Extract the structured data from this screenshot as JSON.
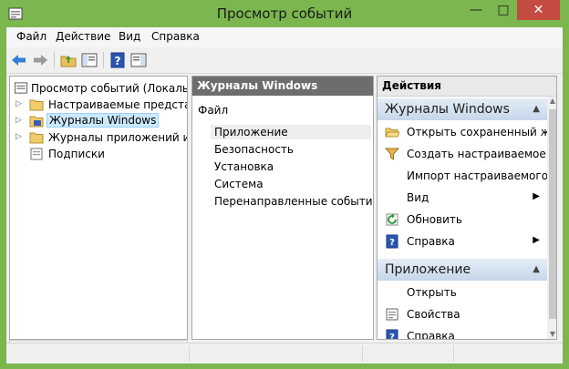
{
  "window": {
    "title": "Просмотр событий",
    "accent": "#7bb64e"
  },
  "titlebar": {
    "minimize": "—",
    "maximize": "□",
    "close": "✕"
  },
  "menubar": {
    "items": [
      "Файл",
      "Действие",
      "Вид",
      "Справка"
    ]
  },
  "toolbar": {
    "icons": [
      "back-arrow-icon",
      "forward-arrow-icon",
      "up-folder-icon",
      "show-hide-tree-icon",
      "help-icon",
      "show-hide-action-pane-icon"
    ]
  },
  "tree": {
    "root": "Просмотр событий (Локальный)",
    "items": [
      {
        "label": "Настраиваемые представления",
        "icon": "folder-icon",
        "expandable": true
      },
      {
        "label": "Журналы Windows",
        "icon": "folder-log-icon",
        "expandable": true,
        "selected": true
      },
      {
        "label": "Журналы приложений и служб",
        "icon": "folder-icon",
        "expandable": true
      },
      {
        "label": "Подписки",
        "icon": "subscriptions-icon",
        "expandable": false
      }
    ]
  },
  "middle": {
    "header": "Журналы Windows",
    "caption": "Файл",
    "items": [
      "Приложение",
      "Безопасность",
      "Установка",
      "Система",
      "Перенаправленные события"
    ]
  },
  "actions": {
    "header": "Действия",
    "group1": {
      "title": "Журналы Windows",
      "rows": [
        {
          "label": "Открыть сохраненный журнал...",
          "icon": "open-folder-icon"
        },
        {
          "label": "Создать настраиваемое представление...",
          "icon": "filter-icon"
        },
        {
          "label": "Импорт настраиваемого представления...",
          "icon": ""
        },
        {
          "label": "Вид",
          "icon": "",
          "submenu": true
        },
        {
          "label": "Обновить",
          "icon": "refresh-icon"
        },
        {
          "label": "Справка",
          "icon": "help-icon",
          "submenu": true
        }
      ]
    },
    "group2": {
      "title": "Приложение",
      "rows": [
        {
          "label": "Открыть",
          "icon": ""
        },
        {
          "label": "Свойства",
          "icon": "properties-icon"
        },
        {
          "label": "Справка",
          "icon": "help-icon"
        }
      ]
    }
  }
}
